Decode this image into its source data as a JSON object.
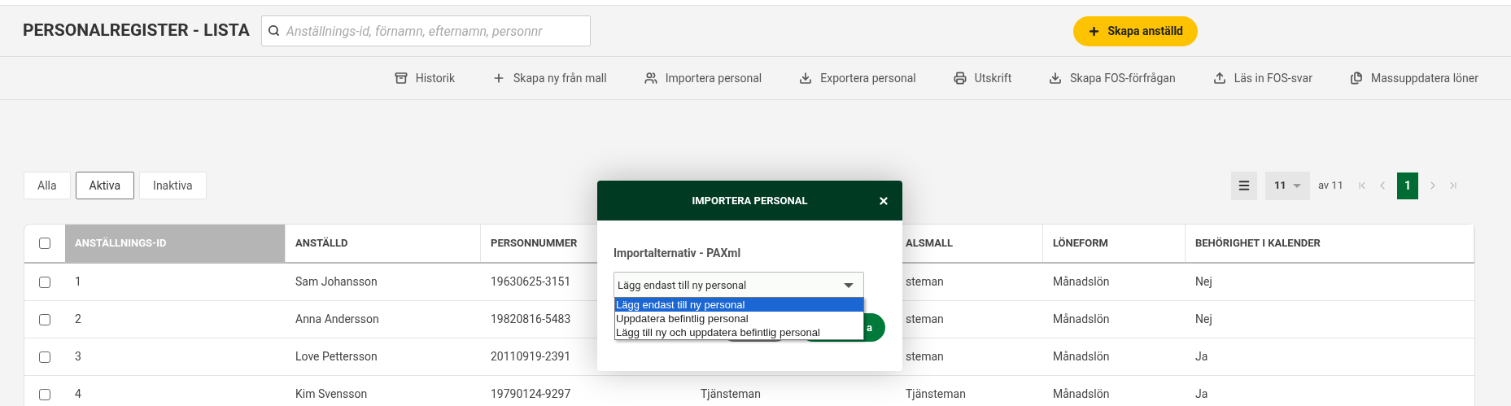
{
  "header": {
    "title": "PERSONALREGISTER - LISTA",
    "search": {
      "placeholder": "Anställnings-id, förnamn, efternamn, personnr"
    },
    "create_button": "Skapa anställd"
  },
  "toolbar": [
    {
      "label": "Historik",
      "kind": "archive"
    },
    {
      "label": "Skapa ny från mall",
      "kind": "plus"
    },
    {
      "label": "Importera personal",
      "kind": "users"
    },
    {
      "label": "Exportera personal",
      "kind": "download"
    },
    {
      "label": "Utskrift",
      "kind": "print"
    },
    {
      "label": "Skapa FOS-förfrågan",
      "kind": "download"
    },
    {
      "label": "Läs in FOS-svar",
      "kind": "upload"
    },
    {
      "label": "Massuppdatera löner",
      "kind": "copy"
    }
  ],
  "filters": [
    {
      "label": "Alla",
      "selected": false
    },
    {
      "label": "Aktiva",
      "selected": true
    },
    {
      "label": "Inaktiva",
      "selected": false
    }
  ],
  "pagination": {
    "page_size": "11",
    "total": "av 11",
    "pages": [
      {
        "label": "1",
        "selected": true
      }
    ]
  },
  "table": {
    "all_checked": false,
    "columns": [
      {
        "label": "ANSTÄLLNINGS-ID",
        "selected": true
      },
      {
        "label": "ANSTÄLLD",
        "selected": false
      },
      {
        "label": "PERSONNUMMER",
        "selected": false
      },
      null,
      {
        "label": "ALSMALL",
        "selected": false
      },
      {
        "label": "LÖNEFORM",
        "selected": false
      },
      {
        "label": "BEHÖRIGHET I KALENDER",
        "selected": false
      }
    ],
    "rows": [
      {
        "checked": false,
        "cells": [
          "1",
          "Sam Johansson",
          "19630625-3151",
          null,
          "steman",
          "Månadslön",
          "Nej"
        ]
      },
      {
        "checked": false,
        "cells": [
          "2",
          "Anna Andersson",
          "19820816-5483",
          null,
          "steman",
          "Månadslön",
          "Nej"
        ]
      },
      {
        "checked": false,
        "cells": [
          "3",
          "Love Pettersson",
          "20110919-2391",
          null,
          "steman",
          "Månadslön",
          "Ja"
        ]
      },
      {
        "checked": false,
        "cells": [
          "4",
          "Kim Svensson",
          "19790124-9297",
          "Tjänsteman",
          "Tjänsteman",
          "Månadslön",
          "Ja"
        ]
      }
    ]
  },
  "modal": {
    "title": "IMPORTERA PERSONAL",
    "label": "Importalternativ - PAXml",
    "select_value": "Lägg endast till ny personal",
    "options": [
      {
        "label": "Lägg endast till ny personal",
        "selected": true
      },
      {
        "label": "Uppdatera befintlig personal",
        "selected": false
      },
      {
        "label": "Lägg till ny och uppdatera befintlig personal",
        "selected": false
      }
    ],
    "confirm_button": "a"
  }
}
